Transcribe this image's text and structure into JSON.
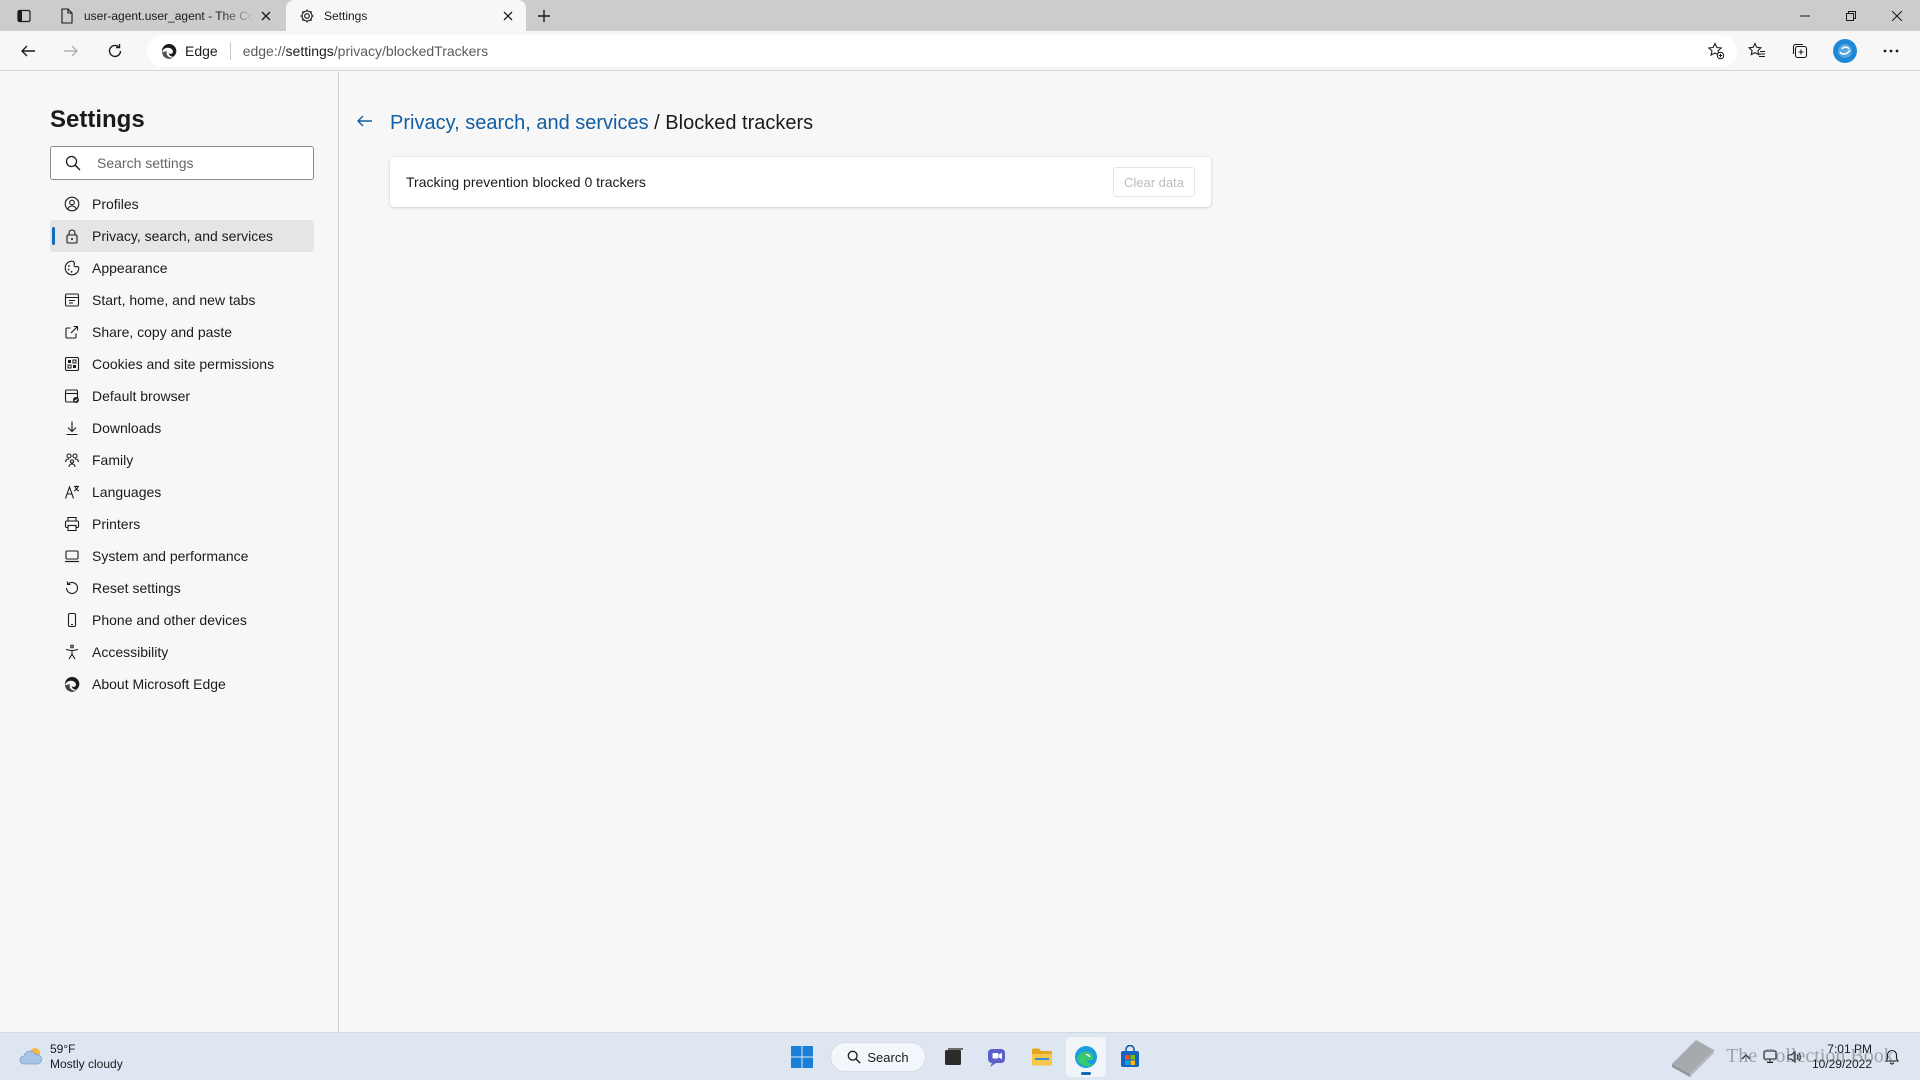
{
  "tabs": [
    {
      "title": "user-agent.user_agent - The Coll"
    },
    {
      "title": "Settings"
    }
  ],
  "toolbar": {
    "site_label": "Edge",
    "url_prefix": "edge://",
    "url_host": "settings",
    "url_path": "/privacy/blockedTrackers"
  },
  "sidebar": {
    "title": "Settings",
    "search_placeholder": "Search settings",
    "items": [
      {
        "label": "Profiles",
        "icon": "profile-icon"
      },
      {
        "label": "Privacy, search, and services",
        "icon": "lock-icon"
      },
      {
        "label": "Appearance",
        "icon": "appearance-icon"
      },
      {
        "label": "Start, home, and new tabs",
        "icon": "home-tabs-icon"
      },
      {
        "label": "Share, copy and paste",
        "icon": "share-icon"
      },
      {
        "label": "Cookies and site permissions",
        "icon": "cookies-icon"
      },
      {
        "label": "Default browser",
        "icon": "browser-icon"
      },
      {
        "label": "Downloads",
        "icon": "download-icon"
      },
      {
        "label": "Family",
        "icon": "family-icon"
      },
      {
        "label": "Languages",
        "icon": "languages-icon"
      },
      {
        "label": "Printers",
        "icon": "printer-icon"
      },
      {
        "label": "System and performance",
        "icon": "system-icon"
      },
      {
        "label": "Reset settings",
        "icon": "reset-icon"
      },
      {
        "label": "Phone and other devices",
        "icon": "phone-icon"
      },
      {
        "label": "Accessibility",
        "icon": "accessibility-icon"
      },
      {
        "label": "About Microsoft Edge",
        "icon": "edge-logo-icon"
      }
    ],
    "selected_index": 1
  },
  "main": {
    "breadcrumb_parent": "Privacy, search, and services",
    "breadcrumb_separator": " / ",
    "breadcrumb_current": "Blocked trackers",
    "card_text": "Tracking prevention blocked 0 trackers",
    "clear_button": "Clear data"
  },
  "taskbar": {
    "temperature": "59°F",
    "weather_desc": "Mostly cloudy",
    "search_label": "Search",
    "time": "7:01 PM",
    "date": "10/29/2022",
    "watermark": "The Collection Book"
  },
  "colors": {
    "accent": "#0f6cbd",
    "link": "#115ea3",
    "selected_bg": "#e5e5e5"
  }
}
